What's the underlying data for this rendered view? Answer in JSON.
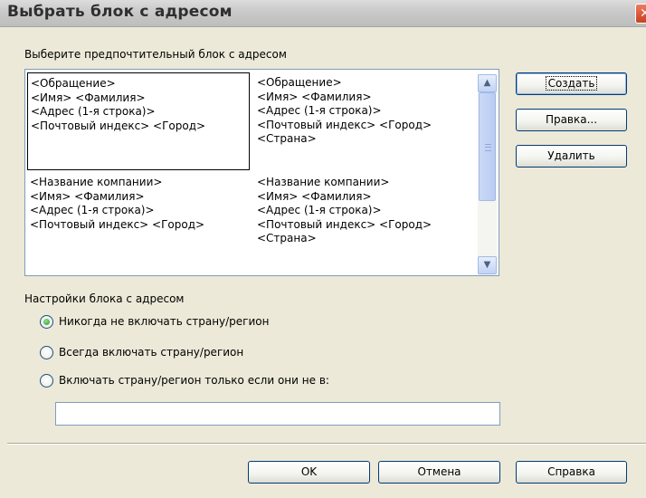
{
  "window": {
    "title": "Выбрать блок с адресом",
    "close_glyph": "✕"
  },
  "list": {
    "label": "Выберите предпочтительный блок с адресом",
    "blocks": [
      {
        "lines": [
          "<Обращение>",
          "<Имя> <Фамилия>",
          "<Адрес (1-я строка)>",
          "<Почтовый индекс> <Город>"
        ],
        "selected": true
      },
      {
        "lines": [
          "<Обращение>",
          "<Имя> <Фамилия>",
          "<Адрес (1-я строка)>",
          "<Почтовый индекс> <Город>",
          "<Страна>"
        ],
        "selected": false
      },
      {
        "lines": [
          "<Название компании>",
          "<Имя> <Фамилия>",
          "<Адрес (1-я строка)>",
          "<Почтовый индекс> <Город>"
        ],
        "selected": false
      },
      {
        "lines": [
          "<Название компании>",
          "<Имя> <Фамилия>",
          "<Адрес (1-я строка)>",
          "<Почтовый индекс> <Город>",
          "<Страна>"
        ],
        "selected": false
      }
    ]
  },
  "side_buttons": {
    "create": "Создать",
    "edit": "Правка...",
    "delete": "Удалить"
  },
  "settings": {
    "label": "Настройки блока с адресом",
    "options": [
      {
        "label": "Никогда не включать страну/регион",
        "checked": true
      },
      {
        "label": "Всегда включать страну/регион",
        "checked": false
      },
      {
        "label": "Включать страну/регион только если они не в:",
        "checked": false
      }
    ],
    "country_value": ""
  },
  "footer": {
    "ok": "OK",
    "cancel": "Отмена",
    "help": "Справка"
  },
  "icons": {
    "scroll_up": "▲",
    "scroll_down": "▼"
  }
}
